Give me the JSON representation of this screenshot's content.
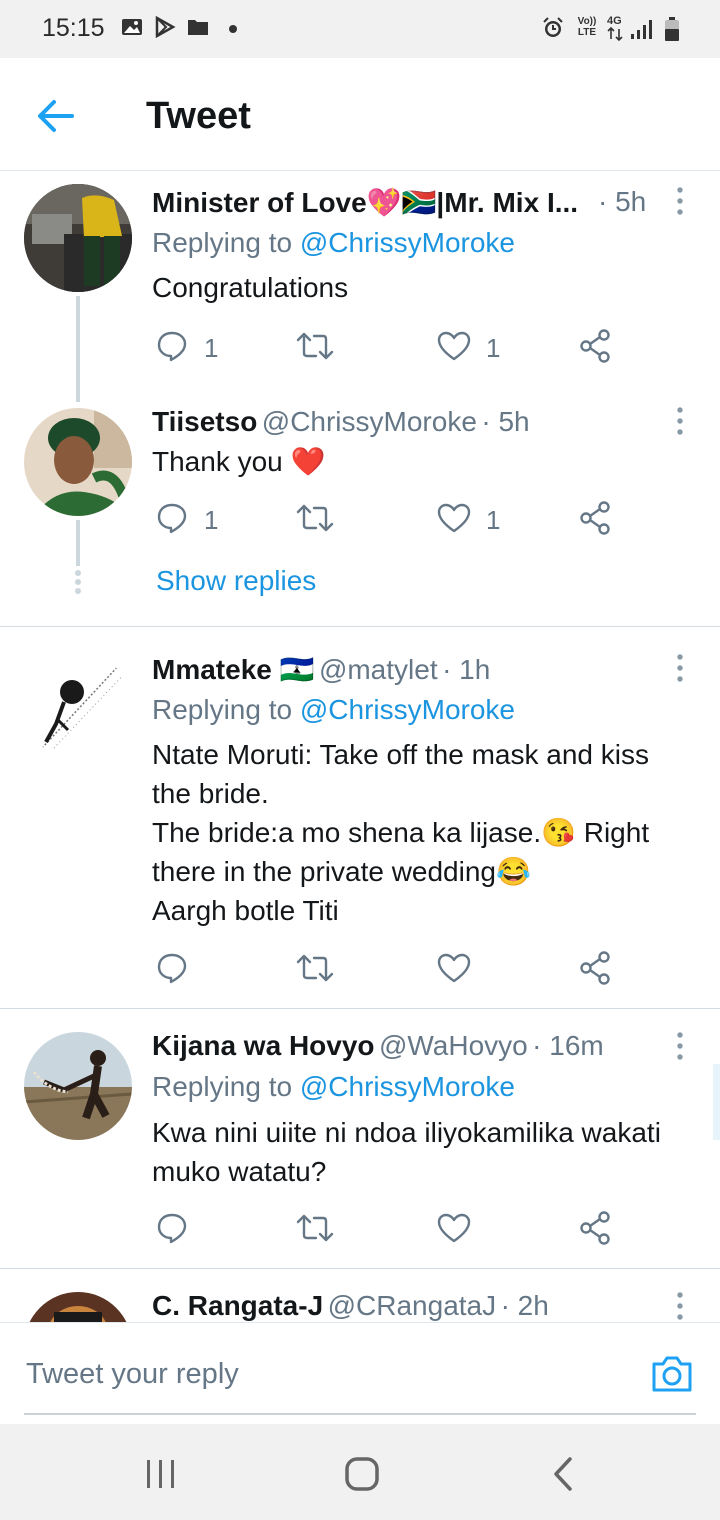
{
  "status_bar": {
    "time": "15:15",
    "left_icons": [
      "image-icon",
      "play-store-icon",
      "folder-icon",
      "dot-icon"
    ],
    "right_icons": [
      "alarm-icon",
      "volte-icon",
      "4g-icon",
      "signal-icon",
      "battery-icon"
    ],
    "volte_label": "Vo)) LTE",
    "net_label": "4G"
  },
  "header": {
    "title": "Tweet"
  },
  "tweets": [
    {
      "name": "Minister of Love💖🇿🇦|Mr. Mix I...",
      "handle": "",
      "time": "· 5h",
      "reply_prefix": "Replying to",
      "reply_handle": "@ChrissyMoroke",
      "text": "Congratulations",
      "reply_count": "1",
      "like_count": "1"
    },
    {
      "name": "Tiisetso",
      "handle": "@ChrissyMoroke",
      "time": "· 5h",
      "text": "Thank you ❤️",
      "reply_count": "1",
      "like_count": "1",
      "show_replies": "Show replies"
    },
    {
      "name": "Mmateke 🇱🇸",
      "handle": "@matylet",
      "time": "· 1h",
      "reply_prefix": "Replying to",
      "reply_handle": "@ChrissyMoroke",
      "lines": [
        "Ntate Moruti: Take off the mask and kiss",
        "the bride.",
        "The bride:a mo shena ka lijase.😘 Right",
        "there in the private wedding😂",
        "Aargh botle Titi"
      ]
    },
    {
      "name": "Kijana wa Hovyo",
      "handle": "@WaHovyo",
      "time": "· 16m",
      "reply_prefix": "Replying to",
      "reply_handle": "@ChrissyMoroke",
      "lines": [
        "Kwa nini uiite ni ndoa iliyokamilika wakati",
        "muko watatu?"
      ]
    },
    {
      "name": "C. Rangata-J",
      "handle": "@CRangataJ",
      "time": "· 2h"
    }
  ],
  "reply_box": {
    "placeholder": "Tweet your reply"
  },
  "colors": {
    "accent": "#1b95e0",
    "muted": "#657786",
    "text": "#14171a"
  }
}
